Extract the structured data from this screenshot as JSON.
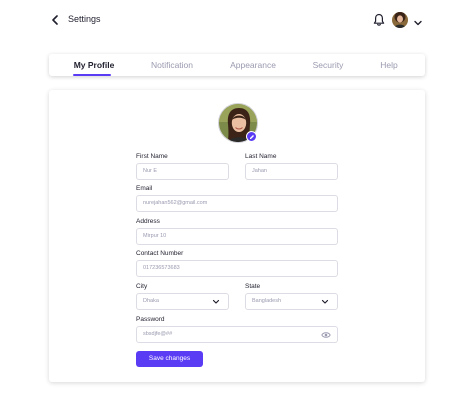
{
  "header": {
    "title": "Settings",
    "back_icon": "chevron-left-icon",
    "notification_icon": "bell-icon",
    "menu_icon": "chevron-down-icon"
  },
  "tabs": [
    {
      "label": "My Profile",
      "active": true
    },
    {
      "label": "Notification",
      "active": false
    },
    {
      "label": "Appearance",
      "active": false
    },
    {
      "label": "Security",
      "active": false
    },
    {
      "label": "Help",
      "active": false
    }
  ],
  "form": {
    "first_name": {
      "label": "First Name",
      "value": "Nur E"
    },
    "last_name": {
      "label": "Last Name",
      "value": "Jahan"
    },
    "email": {
      "label": "Email",
      "value": "nurejahan562@gmail.com"
    },
    "address": {
      "label": "Address",
      "value": "Mirpur 10"
    },
    "contact": {
      "label": "Contact Number",
      "value": "017236573683"
    },
    "city": {
      "label": "City",
      "value": "Dhaka"
    },
    "state": {
      "label": "State",
      "value": "Bangladesh"
    },
    "password": {
      "label": "Password",
      "value": "sbsdjfe@##"
    }
  },
  "save_label": "Save changes",
  "colors": {
    "accent": "#5b3cf5",
    "muted_text": "#9a9ab0",
    "border": "#dcdce4"
  }
}
